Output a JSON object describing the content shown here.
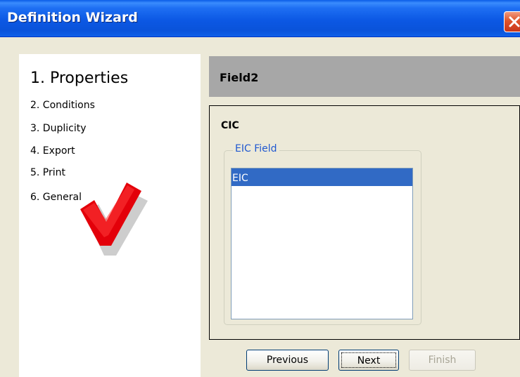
{
  "window": {
    "title": "Definition Wizard",
    "close_icon": "close-icon",
    "titlebar_color": "#0a5ce7",
    "close_color": "#e0542a"
  },
  "steps": {
    "current": "1. Properties",
    "items": [
      "2. Conditions",
      "3. Duplicity",
      "4. Export",
      "5. Print",
      "6. General"
    ],
    "decoration_icon": "red-checkmark-icon"
  },
  "field": {
    "name": "Field2",
    "section_title": "CIC",
    "group_label": "EIC Field",
    "list_items": [
      "EIC"
    ],
    "selected_item": "EIC",
    "selection_color": "#316ac5"
  },
  "buttons": {
    "previous": "Previous",
    "next": "Next",
    "finish": "Finish"
  }
}
